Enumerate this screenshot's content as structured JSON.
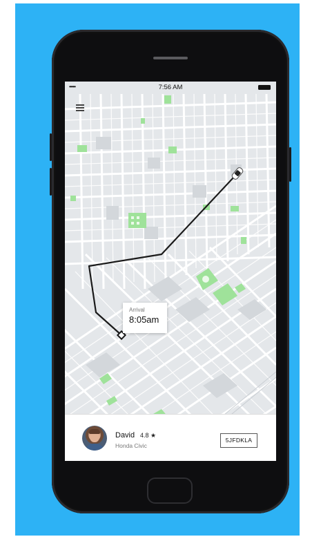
{
  "status_bar": {
    "signal": "•••••",
    "time": "7:56 AM"
  },
  "map": {
    "route_color": "#1a1a1a",
    "park_color": "#9fe29a",
    "street_color": "#ffffff",
    "block_color": "#e4e7ea",
    "car_icon": "car-icon",
    "pickup_marker_icon": "pickup-marker-icon"
  },
  "arrival": {
    "label": "Arrival",
    "time": "8:05am"
  },
  "driver": {
    "name": "David",
    "rating": "4.8 ★",
    "car": "Honda Civic",
    "plate": "5JFDKLA"
  },
  "colors": {
    "background": "#2db2f5",
    "phone": "#0e0e10"
  }
}
